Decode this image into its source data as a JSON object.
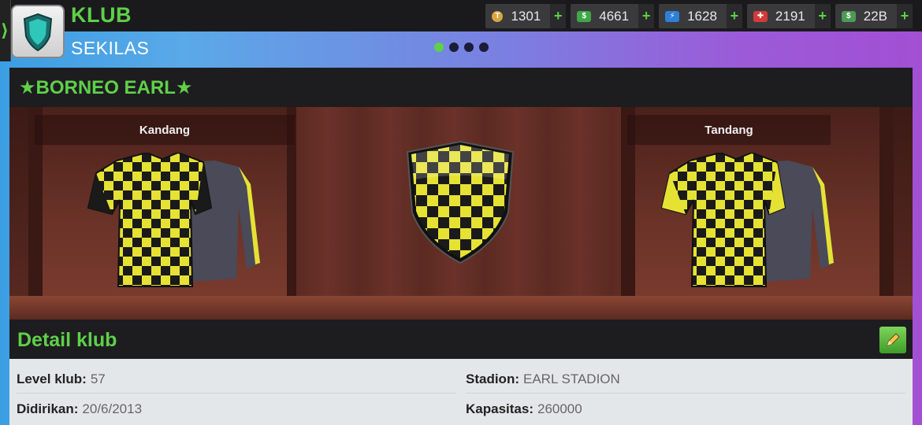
{
  "header": {
    "title": "KLUB",
    "subtitle": "SEKILAS",
    "page_dots": 4,
    "active_dot": 0
  },
  "currencies": [
    {
      "icon": "token-icon",
      "value": "1301",
      "color": "#d9a441"
    },
    {
      "icon": "cash-icon",
      "value": "4661",
      "color": "#3fa64a"
    },
    {
      "icon": "energy-icon",
      "value": "1628",
      "color": "#2f7fd6"
    },
    {
      "icon": "medical-icon",
      "value": "2191",
      "color": "#d23a3a"
    },
    {
      "icon": "money-icon",
      "value": "22B",
      "color": "#4c9a55"
    }
  ],
  "club": {
    "name": "★BORNEO EARL★"
  },
  "kits": {
    "home_label": "Kandang",
    "away_label": "Tandang"
  },
  "details": {
    "title": "Detail klub",
    "level_label": "Level klub:",
    "level_value": "57",
    "founded_label": "Didirikan:",
    "founded_value": "20/6/2013",
    "stadium_label": "Stadion:",
    "stadium_value": "EARL STADION",
    "capacity_label": "Kapasitas:",
    "capacity_value": "260000"
  },
  "colors": {
    "accent": "#5fd04a",
    "kit_yellow": "#e6e234",
    "kit_black": "#1a1a1a"
  }
}
